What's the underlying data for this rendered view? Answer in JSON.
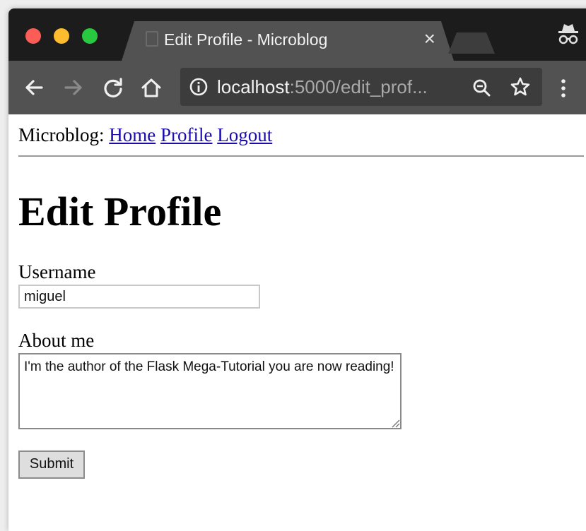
{
  "browser": {
    "tab_title": "Edit Profile - Microblog",
    "tab_close": "×",
    "url_host": "localhost",
    "url_rest": ":5000/edit_prof...",
    "icons": [
      "close-dot",
      "minimize-dot",
      "maximize-dot",
      "page-icon",
      "incognito-icon",
      "back-arrow-icon",
      "forward-arrow-icon",
      "reload-icon",
      "home-icon",
      "info-icon",
      "zoom-icon",
      "star-icon",
      "menu-dots-icon"
    ]
  },
  "page": {
    "brand": "Microblog:",
    "nav": {
      "home": "Home",
      "profile": "Profile",
      "logout": "Logout"
    },
    "title": "Edit Profile",
    "form": {
      "username_label": "Username",
      "username_value": "miguel",
      "about_label": "About me",
      "about_value": "I'm the author of the Flask Mega-Tutorial you are now reading!",
      "submit_label": "Submit"
    }
  },
  "colors": {
    "titlebar": "#1c1c1c",
    "toolbar": "#525252",
    "omnibox": "#3c3c3c",
    "link": "#1a0dab",
    "traffic_red": "#fc5e57",
    "traffic_yellow": "#fdbc2e",
    "traffic_green": "#28c840"
  }
}
